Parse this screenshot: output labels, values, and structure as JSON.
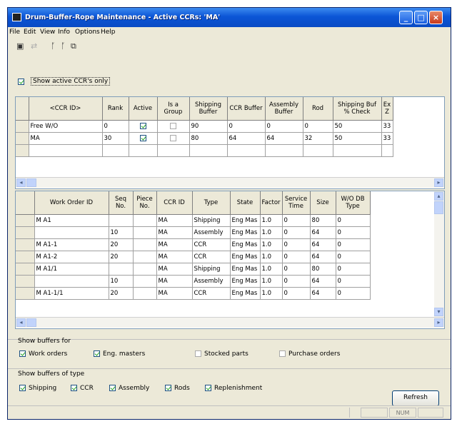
{
  "window": {
    "title": "Drum-Buffer-Rope Maintenance - Active CCRs: 'MA'"
  },
  "menu": [
    "File",
    "Edit",
    "View",
    "Info",
    "Options",
    "Help"
  ],
  "toolbar": {
    "save_icon": "save-icon",
    "undo_icon": "undo-icon",
    "filter_icons": [
      "filter-icon",
      "filter-alt-icon",
      "copy-icon"
    ]
  },
  "active_only": {
    "label": "Show active CCR's only",
    "checked": true
  },
  "ccr_grid": {
    "headers": [
      "<CCR ID>",
      "Rank",
      "Active",
      "Is a Group",
      "Shipping Buffer",
      "CCR Buffer",
      "Assembly Buffer",
      "Rod",
      "Shipping Buf % Check",
      "Ex Z"
    ],
    "rows": [
      {
        "id": "Free W/O",
        "rank": "0",
        "active": true,
        "group": false,
        "ship": "90",
        "ccr": "0",
        "asm": "0",
        "rod": "0",
        "pct": "50",
        "ex": "33"
      },
      {
        "id": "MA",
        "rank": "30",
        "active": true,
        "group": false,
        "ship": "80",
        "ccr": "64",
        "asm": "64",
        "rod": "32",
        "pct": "50",
        "ex": "33"
      }
    ]
  },
  "wo_grid": {
    "headers": [
      "Work Order ID",
      "Seq No.",
      "Piece No.",
      "CCR ID",
      "Type",
      "State",
      "Factor",
      "Service Time",
      "Size",
      "W/O DB Type"
    ],
    "rows": [
      {
        "wo": "M A1",
        "seq": "",
        "piece": "",
        "ccr": "MA",
        "type": "Shipping",
        "state": "Eng Mas",
        "factor": "1.0",
        "svc": "0",
        "size": "80",
        "db": "0"
      },
      {
        "wo": "",
        "seq": "10",
        "piece": "",
        "ccr": "MA",
        "type": "Assembly",
        "state": "Eng Mas",
        "factor": "1.0",
        "svc": "0",
        "size": "64",
        "db": "0"
      },
      {
        "wo": "M A1-1",
        "seq": "20",
        "piece": "",
        "ccr": "MA",
        "type": "CCR",
        "state": "Eng Mas",
        "factor": "1.0",
        "svc": "0",
        "size": "64",
        "db": "0"
      },
      {
        "wo": "M A1-2",
        "seq": "20",
        "piece": "",
        "ccr": "MA",
        "type": "CCR",
        "state": "Eng Mas",
        "factor": "1.0",
        "svc": "0",
        "size": "64",
        "db": "0"
      },
      {
        "wo": "M A1/1",
        "seq": "",
        "piece": "",
        "ccr": "MA",
        "type": "Shipping",
        "state": "Eng Mas",
        "factor": "1.0",
        "svc": "0",
        "size": "80",
        "db": "0"
      },
      {
        "wo": "",
        "seq": "10",
        "piece": "",
        "ccr": "MA",
        "type": "Assembly",
        "state": "Eng Mas",
        "factor": "1.0",
        "svc": "0",
        "size": "64",
        "db": "0"
      },
      {
        "wo": "M A1-1/1",
        "seq": "20",
        "piece": "",
        "ccr": "MA",
        "type": "CCR",
        "state": "Eng Mas",
        "factor": "1.0",
        "svc": "0",
        "size": "64",
        "db": "0"
      }
    ]
  },
  "show_for": {
    "label": "Show buffers for",
    "options": [
      {
        "label": "Work orders",
        "checked": true
      },
      {
        "label": "Eng. masters",
        "checked": true
      },
      {
        "label": "Stocked parts",
        "checked": false
      },
      {
        "label": "Purchase orders",
        "checked": false
      }
    ]
  },
  "show_type": {
    "label": "Show buffers of type",
    "options": [
      {
        "label": "Shipping",
        "checked": true
      },
      {
        "label": "CCR",
        "checked": true
      },
      {
        "label": "Assembly",
        "checked": true
      },
      {
        "label": "Rods",
        "checked": true
      },
      {
        "label": "Replenishment",
        "checked": true
      }
    ]
  },
  "refresh_label": "Refresh",
  "status": {
    "num": "NUM"
  }
}
